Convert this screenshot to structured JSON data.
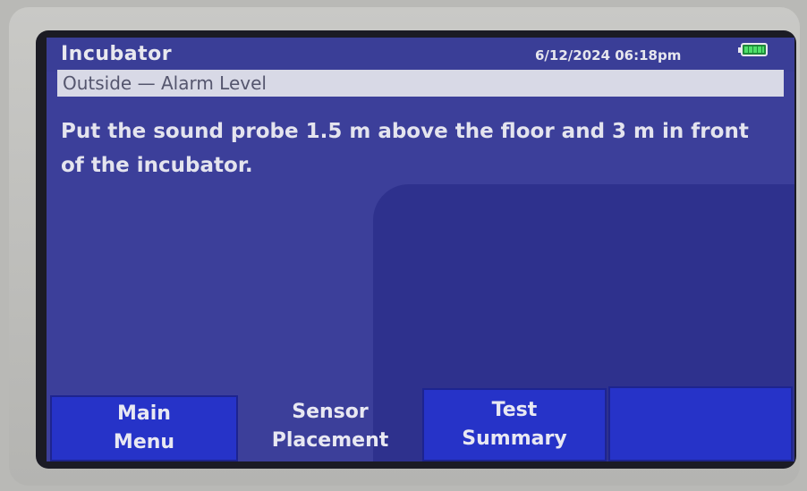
{
  "header": {
    "title": "Incubator",
    "datetime": "6/12/2024 06:18pm",
    "battery_icon": "battery-full-icon"
  },
  "subheader": {
    "text": "Outside — Alarm Level"
  },
  "main": {
    "instruction": "Put the sound probe 1.5 m above the floor and 3 m in front of the incubator."
  },
  "softkeys": [
    {
      "label": "Main\nMenu"
    },
    {
      "label": "Sensor\nPlacement"
    },
    {
      "label": "Test\nSummary"
    },
    {
      "label": ""
    }
  ],
  "colors": {
    "screen_bg": "#3c3f9a",
    "softkey_bg": "#2633c8",
    "text": "#e4e4ee",
    "subbar_bg": "#d8d9e6"
  }
}
